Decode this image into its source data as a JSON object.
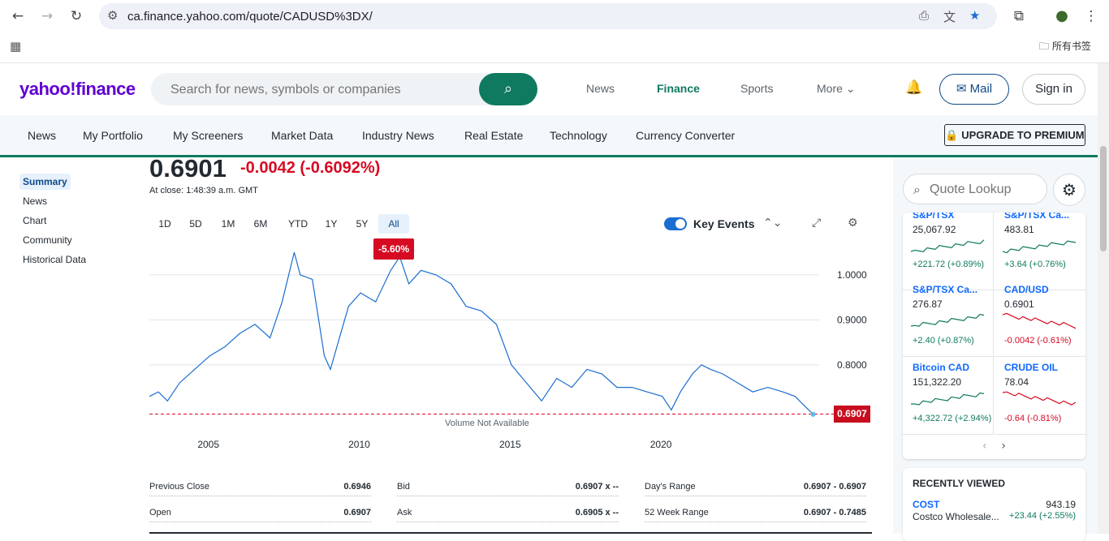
{
  "browser": {
    "url": "ca.finance.yahoo.com/quote/CADUSD%3DX/",
    "bookmarks_folder": "所有书签"
  },
  "header": {
    "logo": "yahoo!finance",
    "search_placeholder": "Search for news, symbols or companies",
    "top_nav": [
      "News",
      "Finance",
      "Sports",
      "More ⌄"
    ],
    "mail": "Mail",
    "signin": "Sign in"
  },
  "subnav": {
    "items": [
      "News",
      "My Portfolio",
      "My Screeners",
      "Market Data",
      "Industry News",
      "Real Estate",
      "Technology",
      "Currency Converter"
    ],
    "premium": "UPGRADE TO PREMIUM"
  },
  "leftnav": [
    "Summary",
    "News",
    "Chart",
    "Community",
    "Historical Data"
  ],
  "quote": {
    "price": "0.6901",
    "change": "-0.0042 (-0.6092%)",
    "close_time": "At close: 1:48:39 a.m. GMT"
  },
  "ranges": [
    "1D",
    "5D",
    "1M",
    "6M",
    "YTD",
    "1Y",
    "5Y",
    "All"
  ],
  "key_events": "Key Events",
  "chart_data": {
    "type": "line",
    "x": [
      2003.0,
      2003.3,
      2003.6,
      2004.0,
      2004.5,
      2005.0,
      2005.5,
      2006.0,
      2006.5,
      2007.0,
      2007.4,
      2007.8,
      2008.0,
      2008.4,
      2008.8,
      2009.0,
      2009.3,
      2009.6,
      2010.0,
      2010.5,
      2011.0,
      2011.3,
      2011.6,
      2012.0,
      2012.5,
      2013.0,
      2013.5,
      2014.0,
      2014.5,
      2015.0,
      2015.5,
      2016.0,
      2016.5,
      2017.0,
      2017.5,
      2018.0,
      2018.5,
      2019.0,
      2019.5,
      2020.0,
      2020.3,
      2020.6,
      2021.0,
      2021.3,
      2021.6,
      2022.0,
      2022.5,
      2023.0,
      2023.5,
      2024.0,
      2024.4,
      2024.7,
      2025.0
    ],
    "y": [
      0.73,
      0.74,
      0.72,
      0.76,
      0.79,
      0.82,
      0.84,
      0.87,
      0.89,
      0.86,
      0.94,
      1.05,
      1.0,
      0.99,
      0.82,
      0.79,
      0.86,
      0.93,
      0.96,
      0.94,
      1.01,
      1.04,
      0.98,
      1.01,
      1.0,
      0.98,
      0.93,
      0.92,
      0.89,
      0.8,
      0.76,
      0.72,
      0.77,
      0.75,
      0.79,
      0.78,
      0.75,
      0.75,
      0.74,
      0.73,
      0.7,
      0.74,
      0.78,
      0.8,
      0.79,
      0.78,
      0.76,
      0.74,
      0.75,
      0.74,
      0.73,
      0.71,
      0.6901
    ],
    "y_ticks": [
      "1.0000",
      "0.9000",
      "0.8000"
    ],
    "y_tick_values": [
      1.0,
      0.9,
      0.8
    ],
    "x_ticks": [
      "2005",
      "2010",
      "2015",
      "2020"
    ],
    "x_tick_values": [
      2005,
      2010,
      2015,
      2020
    ],
    "xlim": [
      2003,
      2025.2
    ],
    "ylim": [
      0.67,
      1.07
    ],
    "reference_line": 0.6907,
    "last_value_label": "0.6907",
    "change_badge": "-5.60%",
    "volume_note": "Volume Not Available",
    "colors": {
      "line": "#1a6dd1",
      "reference": "#d60a22",
      "grid": "#e0e4e9"
    }
  },
  "stats": [
    [
      {
        "label": "Previous Close",
        "value": "0.6946"
      },
      {
        "label": "Bid",
        "value": "0.6907 x --"
      },
      {
        "label": "Day's Range",
        "value": "0.6907 - 0.6907"
      }
    ],
    [
      {
        "label": "Open",
        "value": "0.6907"
      },
      {
        "label": "Ask",
        "value": "0.6905 x --"
      },
      {
        "label": "52 Week Range",
        "value": "0.6907 - 0.7485"
      }
    ]
  ],
  "sidebar": {
    "quote_lookup": "Quote Lookup",
    "cards": [
      {
        "name": "S&P/TSX",
        "price": "25,067.92",
        "change": "+221.72 (+0.89%)",
        "dir": "up"
      },
      {
        "name": "S&P/TSX Ca...",
        "price": "483.81",
        "change": "+3.64 (+0.76%)",
        "dir": "up"
      },
      {
        "name": "S&P/TSX Ca...",
        "price": "276.87",
        "change": "+2.40 (+0.87%)",
        "dir": "up"
      },
      {
        "name": "CAD/USD",
        "price": "0.6901",
        "change": "-0.0042 (-0.61%)",
        "dir": "down"
      },
      {
        "name": "Bitcoin CAD",
        "price": "151,322.20",
        "change": "+4,322.72 (+2.94%)",
        "dir": "up"
      },
      {
        "name": "CRUDE OIL",
        "price": "78.04",
        "change": "-0.64 (-0.81%)",
        "dir": "down"
      }
    ],
    "recently_viewed": "RECENTLY VIEWED",
    "rv_items": [
      {
        "symbol": "COST",
        "name": "Costco Wholesale...",
        "price": "943.19",
        "change": "+23.44 (+2.55%)"
      }
    ]
  }
}
